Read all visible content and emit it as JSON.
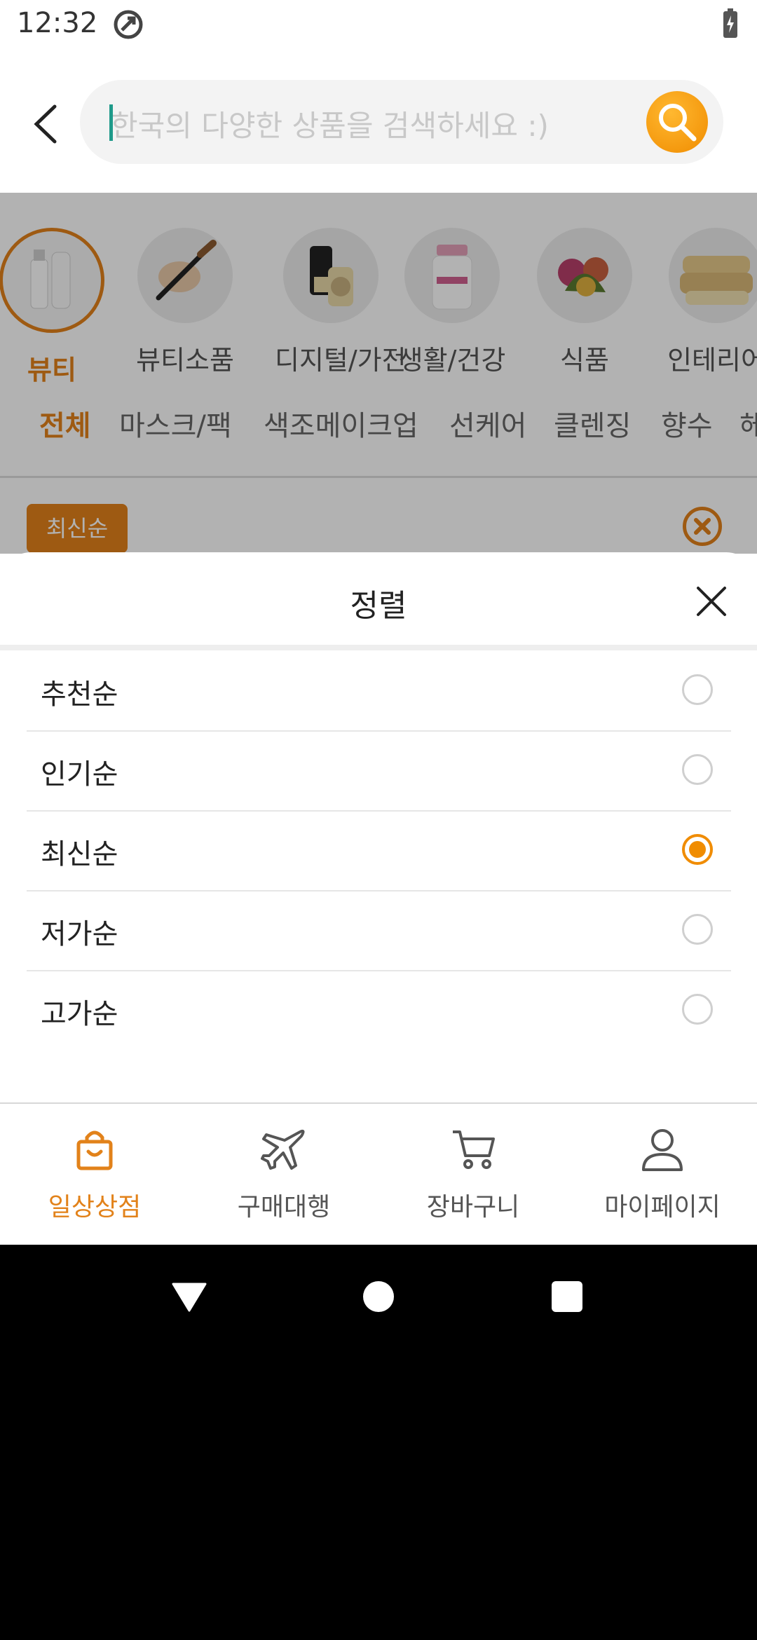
{
  "status_bar": {
    "time": "12:32"
  },
  "search": {
    "placeholder": "한국의 다양한 상품을 검색하세요 :)"
  },
  "categories": [
    {
      "label": "뷰티",
      "active": true,
      "icon": "cosmetics-bottles"
    },
    {
      "label": "뷰티소품",
      "active": false,
      "icon": "makeup-brush"
    },
    {
      "label": "디지털/가전",
      "active": false,
      "icon": "flip-phone"
    },
    {
      "label": "생활/건강",
      "active": false,
      "icon": "supplement-bottle"
    },
    {
      "label": "식품",
      "active": false,
      "icon": "vegetables"
    },
    {
      "label": "인테리어",
      "active": false,
      "icon": "bedding"
    }
  ],
  "subcategories": [
    {
      "label": "전체",
      "active": true
    },
    {
      "label": "마스크/팩",
      "active": false
    },
    {
      "label": "색조메이크업",
      "active": false
    },
    {
      "label": "선케어",
      "active": false
    },
    {
      "label": "클렌징",
      "active": false
    },
    {
      "label": "향수",
      "active": false
    },
    {
      "label": "헤",
      "active": false
    }
  ],
  "active_sort_chip": "최신순",
  "sort_sheet": {
    "title": "정렬",
    "options": [
      {
        "label": "추천순",
        "selected": false
      },
      {
        "label": "인기순",
        "selected": false
      },
      {
        "label": "최신순",
        "selected": true
      },
      {
        "label": "저가순",
        "selected": false
      },
      {
        "label": "고가순",
        "selected": false
      }
    ]
  },
  "bottom_nav": [
    {
      "label": "일상상점",
      "icon": "shopping-bag-icon",
      "active": true
    },
    {
      "label": "구매대행",
      "icon": "airplane-icon",
      "active": false
    },
    {
      "label": "장바구니",
      "icon": "cart-icon",
      "active": false
    },
    {
      "label": "마이페이지",
      "icon": "person-icon",
      "active": false
    }
  ],
  "colors": {
    "accent": "#e2821a",
    "search_button": "#f08c00",
    "text": "#222222"
  }
}
